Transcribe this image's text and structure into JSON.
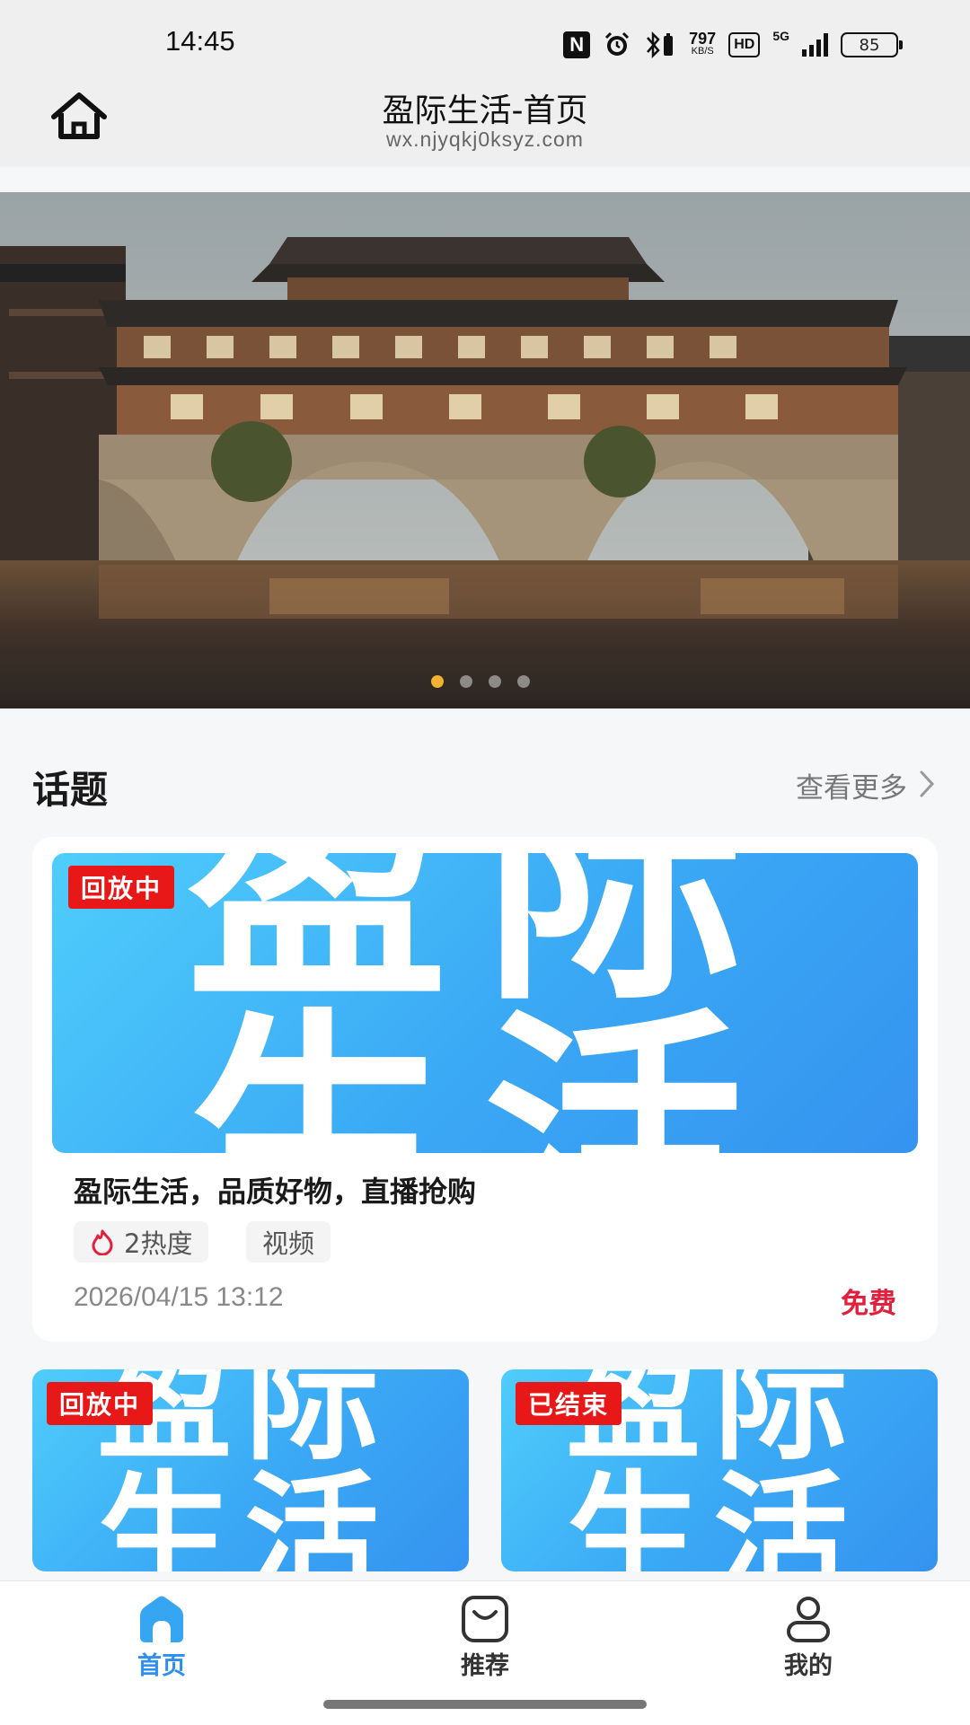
{
  "status_bar": {
    "time": "14:45",
    "nfc": "N",
    "net_speed": "797",
    "net_speed_unit": "KB/S",
    "hd": "HD",
    "network": "5G",
    "battery": "85"
  },
  "header": {
    "title": "盈际生活-首页",
    "url": "wx.njyqkj0ksyz.com"
  },
  "banner": {
    "slide_count": 4,
    "active_index": 0
  },
  "topics": {
    "title": "话题",
    "more_label": "查看更多",
    "featured": {
      "image_text_top": "盈际",
      "image_text_bottom": "生活",
      "badge": "回放中",
      "title": "盈际生活，品质好物，直播抢购",
      "heat": "2热度",
      "type": "视频",
      "date": "2026/04/15 13:12",
      "price": "免费"
    },
    "cards": [
      {
        "image_text_top": "盈际",
        "image_text_bottom": "生活",
        "badge": "回放中"
      },
      {
        "image_text_top": "盈际",
        "image_text_bottom": "生活",
        "badge": "已结束"
      }
    ]
  },
  "bottom_nav": {
    "items": [
      {
        "label": "首页",
        "icon": "home-icon",
        "active": true
      },
      {
        "label": "推荐",
        "icon": "shopping-bag-icon",
        "active": false
      },
      {
        "label": "我的",
        "icon": "user-icon",
        "active": false
      }
    ]
  },
  "colors": {
    "accent": "#2f8ff0",
    "badge": "#e81818",
    "price": "#e0203c",
    "dot_active": "#f2b233"
  }
}
